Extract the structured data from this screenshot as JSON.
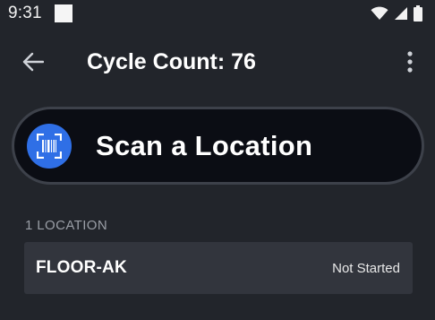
{
  "status_bar": {
    "time": "9:31",
    "icons": [
      "notification-square-icon",
      "wifi-icon",
      "cellular-signal-icon",
      "battery-icon"
    ]
  },
  "header": {
    "title": "Cycle Count: 76",
    "back_icon": "arrow-left-icon",
    "menu_icon": "more-vertical-icon"
  },
  "scan": {
    "label": "Scan a Location",
    "icon": "barcode-scan-icon",
    "accent_color": "#2f6fe6"
  },
  "locations": {
    "header": "1 LOCATION",
    "items": [
      {
        "name": "FLOOR-AK",
        "status": "Not Started"
      }
    ]
  },
  "colors": {
    "background": "#22252b",
    "row_background": "#32353d",
    "scan_background": "#0b0d14"
  }
}
